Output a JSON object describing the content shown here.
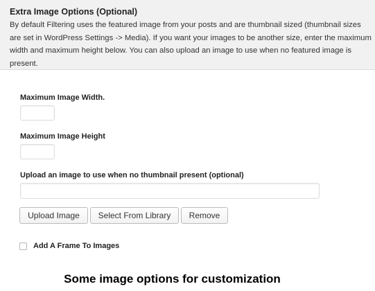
{
  "panel": {
    "title": "Extra Image Options (Optional)",
    "description": "By default Filtering uses the featured image from your posts and are thumbnail sized (thumbnail sizes are set in WordPress Settings -> Media). If you want your images to be another size, enter the maximum width and maximum height below. You can also upload an image to use when no featured image is present."
  },
  "fields": {
    "max_width_label": "Maximum Image Width.",
    "max_width_value": "",
    "max_height_label": "Maximum Image Height",
    "max_height_value": "",
    "upload_label": "Upload an image to use when no thumbnail present (optional)",
    "upload_value": ""
  },
  "buttons": {
    "upload": "Upload Image",
    "select_library": "Select From Library",
    "remove": "Remove"
  },
  "frame_option": {
    "label": "Add A Frame To Images",
    "checked": false
  },
  "caption": "Some image options for customization"
}
